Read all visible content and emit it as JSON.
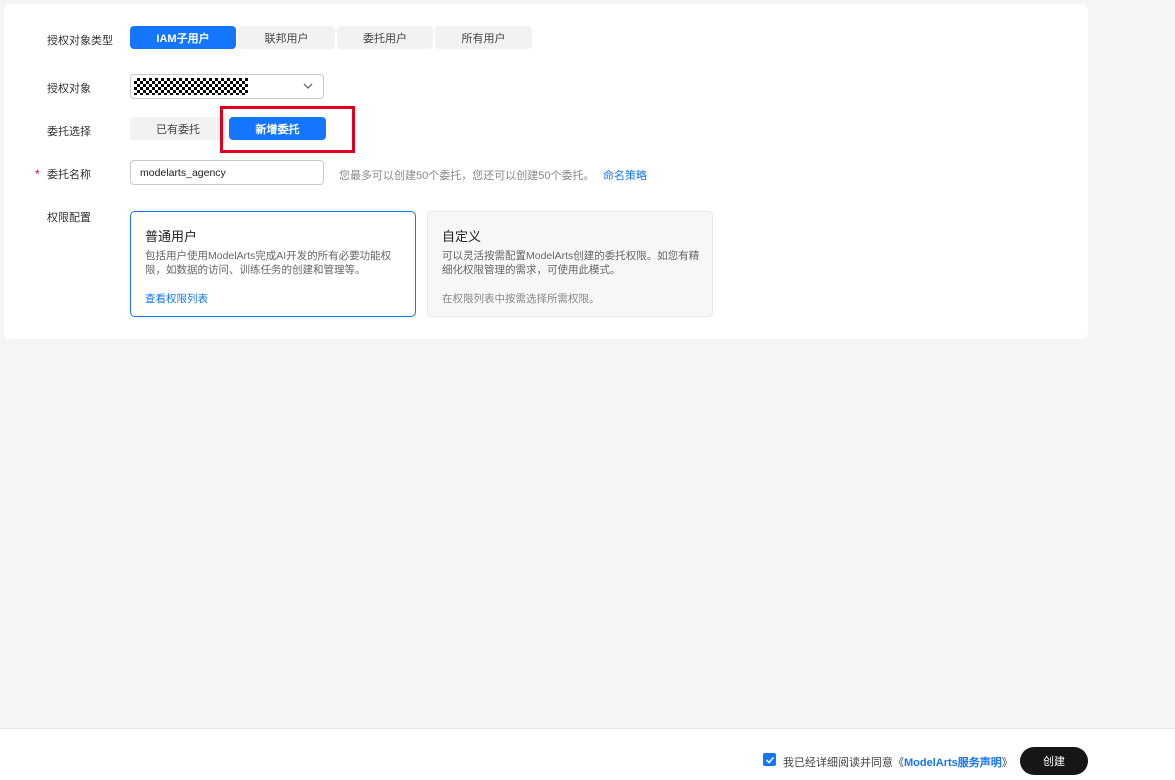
{
  "form": {
    "target_type": {
      "label": "授权对象类型",
      "options": [
        "IAM子用户",
        "联邦用户",
        "委托用户",
        "所有用户"
      ],
      "selected": "IAM子用户"
    },
    "target": {
      "label": "授权对象"
    },
    "agency_choice": {
      "label": "委托选择",
      "options": [
        "已有委托",
        "新增委托"
      ],
      "selected": "新增委托"
    },
    "agency_name": {
      "label": "委托名称",
      "required_mark": "*",
      "value": "modelarts_agency",
      "hint": "您最多可以创建50个委托，您还可以创建50个委托。",
      "naming_link": "命名策略"
    },
    "permission": {
      "label": "权限配置",
      "cards": [
        {
          "title": "普通用户",
          "desc": "包括用户使用ModelArts完成AI开发的所有必要功能权限，如数据的访问、训练任务的创建和管理等。",
          "footer": "查看权限列表"
        },
        {
          "title": "自定义",
          "desc": "可以灵活按需配置ModelArts创建的委托权限。如您有精细化权限管理的需求，可使用此模式。",
          "footer": "在权限列表中按需选择所需权限。"
        }
      ]
    }
  },
  "footer": {
    "agree_prefix": "我已经详细阅读并同意《",
    "agree_link": "ModelArts服务声明",
    "agree_suffix": "》",
    "checkbox_checked": true,
    "create_label": "创建"
  },
  "colors": {
    "accent": "#1476ff",
    "highlight": "#e0001b",
    "dark_button": "#161616"
  }
}
